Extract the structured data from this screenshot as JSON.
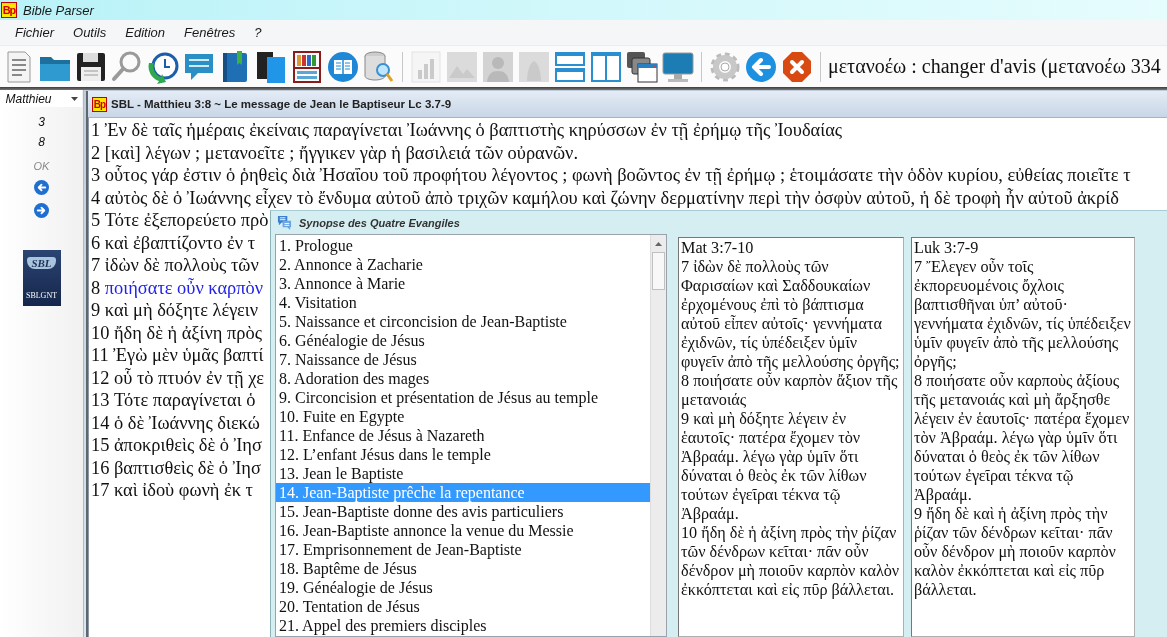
{
  "window": {
    "logo": "Bp",
    "title": "Bible Parser"
  },
  "menu": [
    "Fichier",
    "Outils",
    "Edition",
    "Fenêtres",
    "?"
  ],
  "toolbar": {
    "buttons": [
      {
        "disabled": false
      },
      {
        "disabled": false
      },
      {
        "disabled": false
      },
      {
        "disabled": false
      },
      {
        "disabled": false
      },
      {
        "disabled": false
      },
      {
        "disabled": false
      },
      {
        "disabled": false
      },
      {
        "disabled": false
      },
      {
        "disabled": false
      },
      {
        "disabled": false
      },
      {
        "disabled": true
      },
      {
        "disabled": true
      },
      {
        "disabled": true
      },
      {
        "disabled": true
      },
      {
        "disabled": false
      },
      {
        "disabled": false
      },
      {
        "disabled": false
      },
      {
        "disabled": false
      },
      {
        "disabled": false
      },
      {
        "disabled": false
      },
      {
        "disabled": false
      }
    ],
    "definition": "μετανοέω : changer d'avis (μετανοέω 334"
  },
  "navigator": {
    "book": "Matthieu",
    "chapter": "3",
    "verse": "8",
    "ok": "OK",
    "logo": {
      "monogram": "SBL",
      "caption": "SBLGNT"
    }
  },
  "document": {
    "logo": "Bp",
    "title": "SBL - Matthieu 3:8 ~ Le message de Jean le Baptiseur Lc 3.7-9",
    "verses": [
      {
        "number": "1",
        "text": "Ἐν δὲ ταῖς ἡμέραις ἐκείναις παραγίνεται Ἰωάννης ὁ βαπτιστὴς κηρύσσων ἐν τῇ ἐρήμῳ τῆς Ἰουδαίας",
        "selected": false
      },
      {
        "number": "2",
        "text": "[καὶ] λέγων ; μετανοεῖτε ; ἤγγικεν γὰρ ἡ βασιλειά τῶν οὐρανῶν.",
        "selected": false
      },
      {
        "number": "3",
        "text": "οὗτος γάρ ἐστιν ὁ ῥηθεὶς διὰ Ἠσαΐου τοῦ προφήτου λέγοντος ; φωνὴ βοῶντος ἐν τῇ ἐρήμῳ ; ἑτοιμάσατε τὴν ὁδὸν κυρίου, εὐθείας ποιεῖτε τ",
        "selected": false
      },
      {
        "number": "4",
        "text": "αὐτὸς δὲ ὁ Ἰωάννης εἶχεν τὸ ἔνδυμα αὐτοῦ ἀπὸ τριχῶν καμήλου καὶ ζώνην δερματίνην περὶ τὴν ὀσφὺν αὐτοῦ, ἡ δὲ τροφὴ ἦν αὐτοῦ ἀκρίδ",
        "selected": false
      },
      {
        "number": "5",
        "text": "Τότε ἐξεπορεύετο πρὸ",
        "selected": false
      },
      {
        "number": "6",
        "text": "καὶ ἐβαπτίζοντο ἐν τ",
        "selected": false
      },
      {
        "number": "7",
        "text": "ἰδὼν δὲ πολλοὺς τῶν",
        "selected": false
      },
      {
        "number": "8",
        "text": "ποιήσατε οὖν καρπὸν",
        "selected": true
      },
      {
        "number": "9",
        "text": "καὶ μὴ δόξητε λέγειν",
        "selected": false
      },
      {
        "number": "10",
        "text": "ἤδη δὲ ἡ ἀξίνη πρὸς",
        "selected": false
      },
      {
        "number": "11",
        "text": "Ἐγὼ μὲν ὑμᾶς βαπτί",
        "selected": false
      },
      {
        "number": "12",
        "text": "οὗ τὸ πτυόν ἐν τῇ χε",
        "selected": false
      },
      {
        "number": "13",
        "text": "Τότε παραγίνεται ὁ",
        "selected": false
      },
      {
        "number": "14",
        "text": "ὁ δὲ Ἰωάννης διεκώ",
        "selected": false
      },
      {
        "number": "15",
        "text": "ἀποκριθεὶς δὲ ὁ Ἰησ",
        "selected": false
      },
      {
        "number": "16",
        "text": "βαπτισθεὶς δὲ ὁ Ἰησ",
        "selected": false
      },
      {
        "number": "17",
        "text": "καὶ ἰδοὺ φωνὴ ἐκ τ",
        "selected": false
      }
    ]
  },
  "synopsis": {
    "title": "Synopse des Quatre Evangiles",
    "sections": [
      {
        "label": "1. Prologue",
        "selected": false
      },
      {
        "label": "2. Annonce à Zacharie",
        "selected": false
      },
      {
        "label": "3. Annonce à Marie",
        "selected": false
      },
      {
        "label": "4. Visitation",
        "selected": false
      },
      {
        "label": "5. Naissance et circoncision de Jean-Baptiste",
        "selected": false
      },
      {
        "label": "6. Généalogie de Jésus",
        "selected": false
      },
      {
        "label": "7. Naissance de Jésus",
        "selected": false
      },
      {
        "label": "8. Adoration des mages",
        "selected": false
      },
      {
        "label": "9. Circoncision et présentation de Jésus au temple",
        "selected": false
      },
      {
        "label": "10. Fuite en Egypte",
        "selected": false
      },
      {
        "label": "11. Enfance de Jésus à Nazareth",
        "selected": false
      },
      {
        "label": "12. L’enfant Jésus dans le temple",
        "selected": false
      },
      {
        "label": "13. Jean le Baptiste",
        "selected": false
      },
      {
        "label": "14. Jean-Baptiste prêche la repentance",
        "selected": true
      },
      {
        "label": "15. Jean-Baptiste donne des avis particuliers",
        "selected": false
      },
      {
        "label": "16. Jean-Baptiste annonce la venue du Messie",
        "selected": false
      },
      {
        "label": "17. Emprisonnement de Jean-Baptiste",
        "selected": false
      },
      {
        "label": "18. Baptême de Jésus",
        "selected": false
      },
      {
        "label": "19. Généalogie de Jésus",
        "selected": false
      },
      {
        "label": "20. Tentation de Jésus",
        "selected": false
      },
      {
        "label": "21. Appel des premiers disciples",
        "selected": false
      }
    ],
    "panels": [
      {
        "reference": "Mat 3:7-10",
        "verses": [
          "7 ἰδὼν δὲ πολλοὺς τῶν Φαρισαίων καὶ Σαδδουκαίων ἐρχομένους ἐπὶ τὸ βάπτισμα αὐτοῦ εἶπεν αὐτοῖς· γεννήματα ἐχιδνῶν, τίς ὑπέδειξεν ὑμῖν φυγεῖν ἀπὸ τῆς μελλούσης ὀργῆς;",
          "8 ποιήσατε οὖν καρπὸν ἄξιον τῆς μετανοιάς",
          "9 καὶ μὴ δόξητε λέγειν ἐν ἑαυτοῖς· πατέρα ἔχομεν τὸν Ἀβραάμ. λέγω γὰρ ὑμῖν ὅτι δύναται ὁ θεὸς ἐκ τῶν λίθων τούτων ἐγεῖραι τέκνα τῷ Ἀβραάμ.",
          "10 ἤδη δὲ ἡ ἀξίνη πρὸς τὴν ῥίζαν τῶν δένδρων κεῖται· πᾶν οὖν δένδρον μὴ ποιοῦν καρπὸν καλὸν ἐκκόπτεται καὶ εἰς πῦρ βάλλεται."
        ]
      },
      {
        "reference": "Luk 3:7-9",
        "verses": [
          "7 Ἔλεγεν οὖν τοῖς ἐκπορευομένοις ὄχλοις βαπτισθῆναι ὑπ’ αὐτοῦ· γεννήματα ἐχιδνῶν, τίς ὑπέδειξεν ὑμῖν φυγεῖν ἀπὸ τῆς μελλούσης ὀργῆς;",
          "8 ποιήσατε οὖν καρποὺς ἀξίους τῆς μετανοιάς καὶ μὴ ἄρξησθε λέγειν ἐν ἑαυτοῖς· πατέρα ἔχομεν τὸν Ἀβραάμ. λέγω γὰρ ὑμῖν ὅτι δύναται ὁ θεὸς ἐκ τῶν λίθων τούτων ἐγεῖραι τέκνα τῷ Ἀβραάμ.",
          "9 ἤδη δὲ καὶ ἡ ἀξίνη πρὸς τὴν ῥίζαν τῶν δένδρων κεῖται· πᾶν οὖν δένδρον μὴ ποιοῦν καρπὸν καλὸν ἐκκόπτεται καὶ εἰς πῦρ βάλλεται."
        ]
      }
    ]
  }
}
